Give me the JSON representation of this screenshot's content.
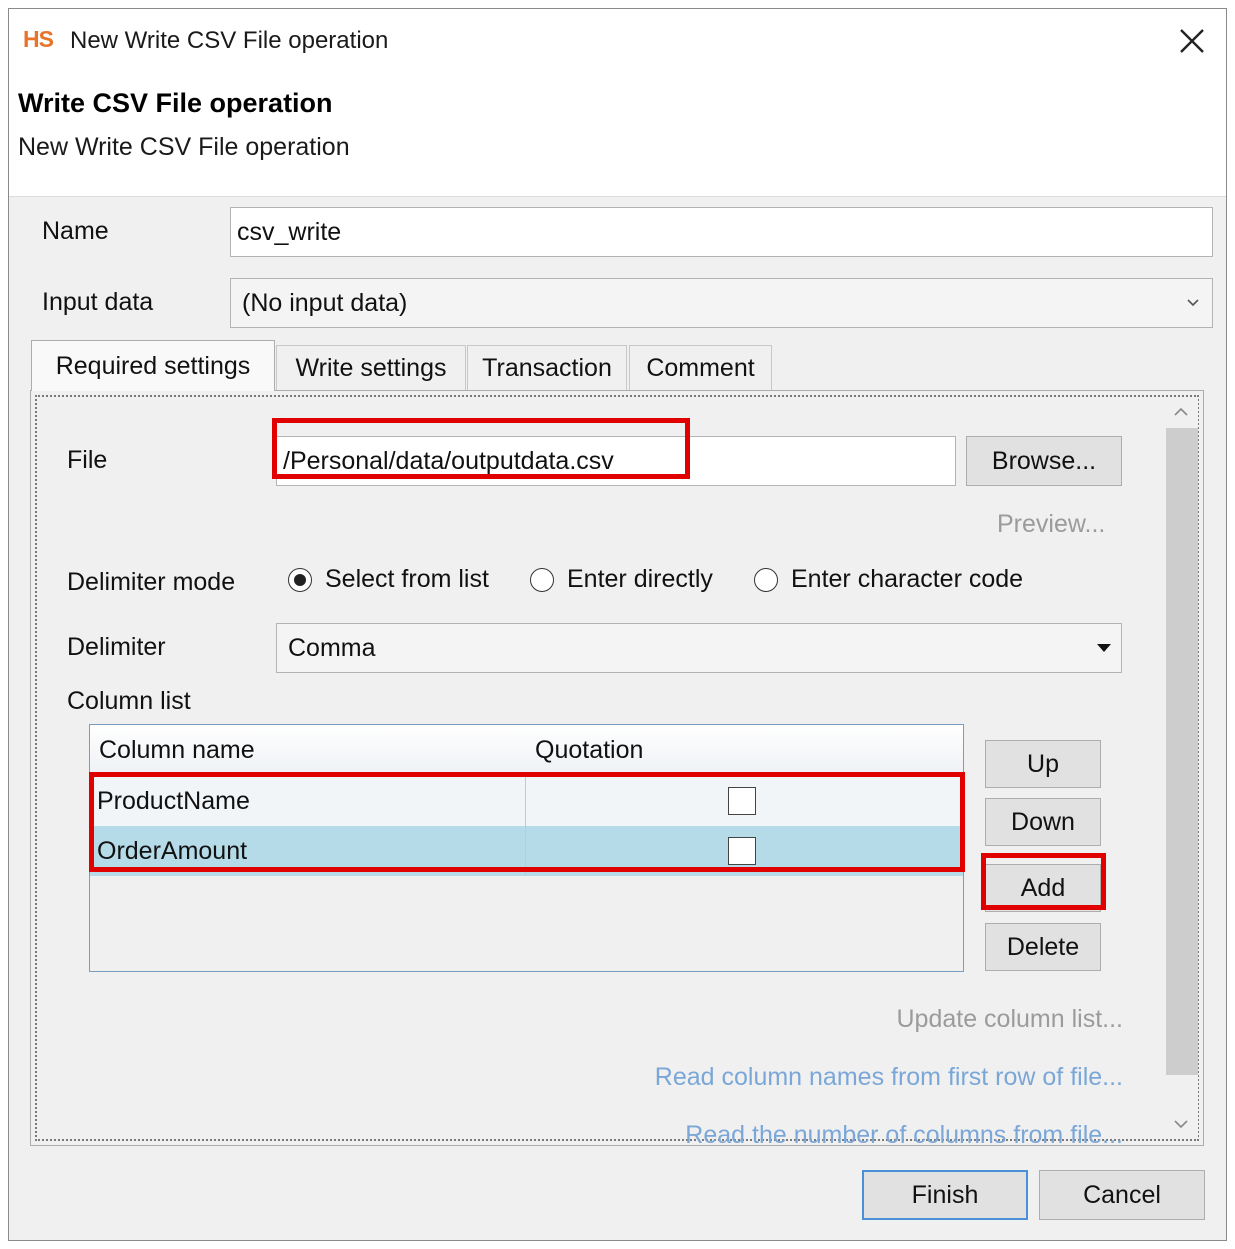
{
  "window": {
    "logo": "HS",
    "title": "New Write CSV File operation"
  },
  "header": {
    "title": "Write CSV File operation",
    "description": "New Write CSV File operation"
  },
  "form": {
    "name_label": "Name",
    "name_value": "csv_write",
    "input_label": "Input data",
    "input_value": "(No input data)"
  },
  "tabs": [
    {
      "label": "Required settings",
      "active": true
    },
    {
      "label": "Write settings",
      "active": false
    },
    {
      "label": "Transaction",
      "active": false
    },
    {
      "label": "Comment",
      "active": false
    }
  ],
  "required": {
    "file_label": "File",
    "file_value": "/Personal/data/outputdata.csv",
    "browse_label": "Browse...",
    "preview_label": "Preview...",
    "delimiter_mode_label": "Delimiter mode",
    "delimiter_modes": [
      {
        "label": "Select from list",
        "selected": true
      },
      {
        "label": "Enter directly",
        "selected": false
      },
      {
        "label": "Enter character code",
        "selected": false
      }
    ],
    "delimiter_label": "Delimiter",
    "delimiter_value": "Comma",
    "column_list_label": "Column list",
    "columns_header": [
      "Column name",
      "Quotation"
    ],
    "columns": [
      {
        "name": "ProductName",
        "quotation": false
      },
      {
        "name": "OrderAmount",
        "quotation": false
      }
    ],
    "buttons": {
      "up": "Up",
      "down": "Down",
      "add": "Add",
      "delete": "Delete"
    },
    "links": {
      "update": "Update column list...",
      "read_names": "Read column names from first row of file...",
      "read_count": "Read the number of columns from file..."
    }
  },
  "footer": {
    "finish": "Finish",
    "cancel": "Cancel"
  },
  "colors": {
    "highlight": "#e00000",
    "selected_row": "#b5dbe9",
    "logo": "#e8742a",
    "link": "#7aa7d8"
  }
}
